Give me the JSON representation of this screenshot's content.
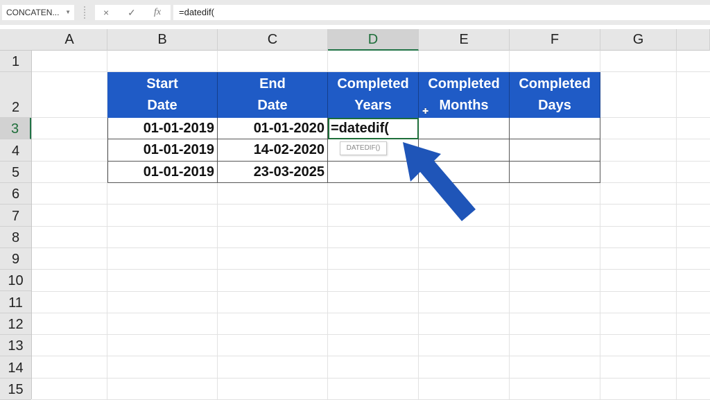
{
  "formula_bar": {
    "name_box": "CONCATEN...",
    "cancel_icon": "×",
    "enter_icon": "✓",
    "fx_label": "fx",
    "formula": "=datedif("
  },
  "columns": [
    "A",
    "B",
    "C",
    "D",
    "E",
    "F",
    "G",
    ""
  ],
  "active_column": "D",
  "rows": [
    "1",
    "2",
    "3",
    "4",
    "5",
    "6",
    "7",
    "8",
    "9",
    "10",
    "11",
    "12",
    "13",
    "14",
    "15"
  ],
  "active_row": "3",
  "table": {
    "headers": [
      "Start\nDate",
      "End\nDate",
      "Completed\nYears",
      "Completed\nMonths",
      "Completed\nDays"
    ],
    "rows": [
      [
        "01-01-2019",
        "01-01-2020",
        "=datedif(",
        "",
        ""
      ],
      [
        "01-01-2019",
        "14-02-2020",
        "",
        "",
        ""
      ],
      [
        "01-01-2019",
        "23-03-2025",
        "",
        "",
        ""
      ]
    ]
  },
  "autocomplete_tooltip": "DATEDIF()",
  "colors": {
    "header_fill": "#1f5bc6",
    "arrow": "#1f55b8",
    "active_accent": "#217346"
  }
}
